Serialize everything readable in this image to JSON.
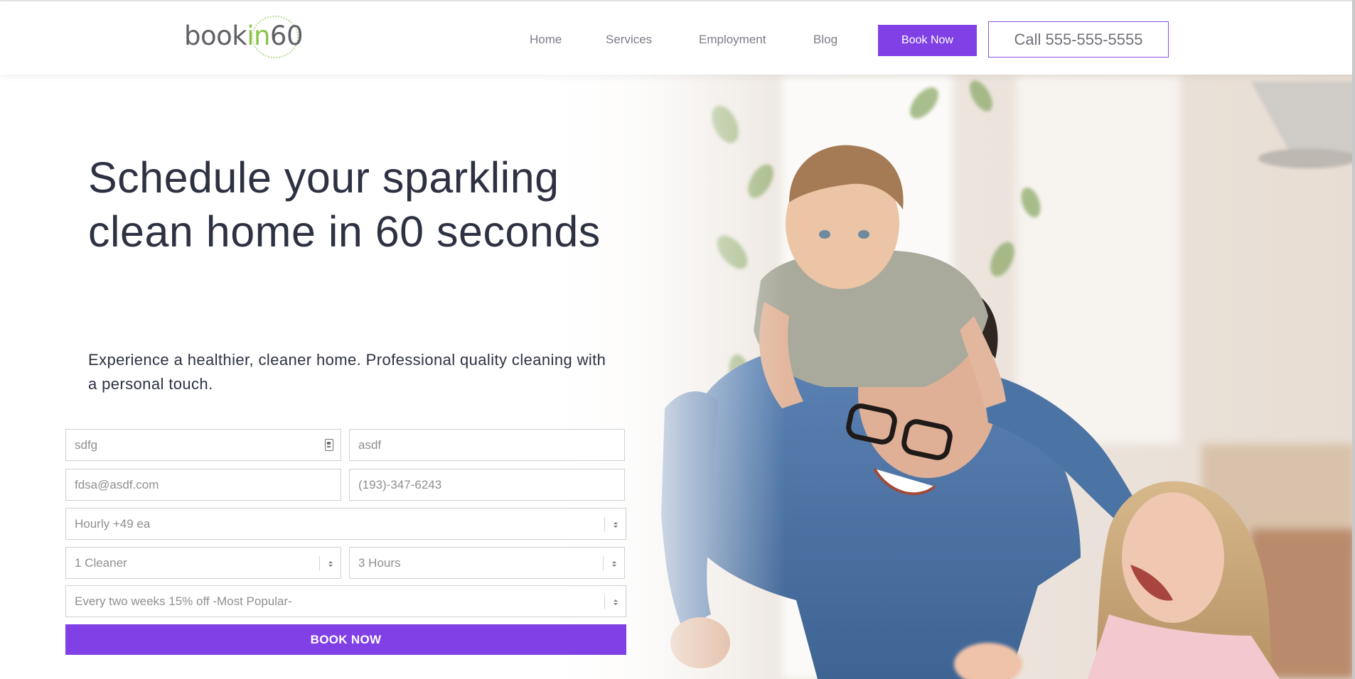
{
  "header": {
    "logo": {
      "part1": "book",
      "part2": "in",
      "part3": "60"
    },
    "nav": [
      {
        "label": "Home"
      },
      {
        "label": "Services"
      },
      {
        "label": "Employment"
      },
      {
        "label": "Blog"
      }
    ],
    "book_now_label": "Book Now",
    "call_label": "Call 555-555-5555"
  },
  "hero": {
    "title": "Schedule your sparkling clean home in 60 seconds",
    "subtitle": "Experience a healthier, cleaner home. Professional quality cleaning with a personal touch.",
    "image_description_icon": "family-photo-image"
  },
  "form": {
    "first_name_value": "sdfg",
    "last_name_value": "asdf",
    "email_value": "fdsa@asdf.com",
    "phone_value": "(193)-347-6243",
    "service_selected": "Hourly +49 ea",
    "cleaners_selected": "1 Cleaner",
    "hours_selected": "3 Hours",
    "frequency_selected": "Every two weeks 15% off -Most Popular-",
    "submit_label": "BOOK NOW"
  },
  "colors": {
    "accent": "#8040e6",
    "heading": "#2d3142",
    "logo_green": "#8bc34a",
    "nav_text": "#7a7d85"
  }
}
